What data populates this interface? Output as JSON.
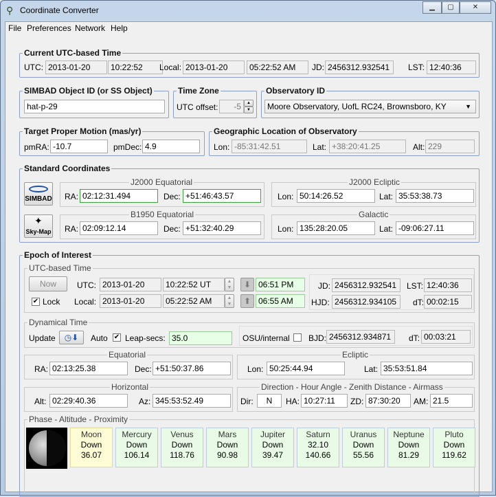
{
  "window": {
    "title": "Coordinate Converter",
    "min": "▁",
    "max": "▢",
    "close": "✕"
  },
  "menu": [
    "File",
    "Preferences",
    "Network",
    "Help"
  ],
  "utc": {
    "title": "Current UTC-based Time",
    "utc_label": "UTC:",
    "utc_date": "2013-01-20",
    "utc_time": "10:22:52",
    "local_label": "Local:",
    "local_date": "2013-01-20",
    "local_time": "05:22:52 AM",
    "jd_label": "JD:",
    "jd": "2456312.932541",
    "lst_label": "LST:",
    "lst": "12:40:36"
  },
  "simbad": {
    "title": "SIMBAD Object ID (or SS Object)",
    "value": "hat-p-29"
  },
  "timezone": {
    "title": "Time Zone",
    "label": "UTC offset:",
    "value": "-5"
  },
  "observatory": {
    "title": "Observatory ID",
    "value": "Moore Observatory, UofL RC24, Brownsboro, KY"
  },
  "motion": {
    "title": "Target Proper Motion (mas/yr)",
    "pmra_label": "pmRA:",
    "pmra": "-10.7",
    "pmdec_label": "pmDec:",
    "pmdec": "4.9"
  },
  "geo": {
    "title": "Geographic Location of Observatory",
    "lon_label": "Lon:",
    "lon": "-85:31:42.51",
    "lat_label": "Lat:",
    "lat": "+38:20:41.25",
    "alt_label": "Alt:",
    "alt": "229"
  },
  "std": {
    "title": "Standard Coordinates",
    "simbad_btn": "SIMBAD",
    "skymap_btn": "Sky-Map",
    "j2000eq": {
      "title": "J2000 Equatorial",
      "ra_label": "RA:",
      "ra": "02:12:31.494",
      "dec_label": "Dec:",
      "dec": "+51:46:43.57"
    },
    "j2000ec": {
      "title": "J2000 Ecliptic",
      "lon_label": "Lon:",
      "lon": "50:14:26.52",
      "lat_label": "Lat:",
      "lat": "35:53:38.73"
    },
    "b1950": {
      "title": "B1950 Equatorial",
      "ra_label": "RA:",
      "ra": "02:09:12.14",
      "dec_label": "Dec:",
      "dec": "+51:32:40.29"
    },
    "galactic": {
      "title": "Galactic",
      "lon_label": "Lon:",
      "lon": "135:28:20.05",
      "lat_label": "Lat:",
      "lat": "-09:06:27.11"
    }
  },
  "epoch": {
    "title": "Epoch of Interest",
    "utcb": {
      "title": "UTC-based Time",
      "now": "Now",
      "lock": "Lock",
      "utc_label": "UTC:",
      "utc_date": "2013-01-20",
      "utc_time": "10:22:52 UT",
      "local_label": "Local:",
      "local_date": "2013-01-20",
      "local_time": "05:22:52 AM",
      "set_time": "06:51 PM",
      "rise_time": "06:55 AM",
      "jd_label": "JD:",
      "jd": "2456312.932541",
      "lst_label": "LST:",
      "lst": "12:40:36",
      "hjd_label": "HJD:",
      "hjd": "2456312.934105",
      "dt_label": "dT:",
      "dt": "00:02:15"
    },
    "dyn": {
      "title": "Dynamical Time",
      "update": "Update",
      "auto": "Auto",
      "leap_label": "Leap-secs:",
      "leap": "35.0",
      "osu_label": "OSU/internal",
      "bjd_label": "BJD:",
      "bjd": "2456312.934871",
      "dt_label": "dT:",
      "dt": "00:03:21"
    },
    "eq": {
      "title": "Equatorial",
      "ra_label": "RA:",
      "ra": "02:13:25.38",
      "dec_label": "Dec:",
      "dec": "+51:50:37.86"
    },
    "ec": {
      "title": "Ecliptic",
      "lon_label": "Lon:",
      "lon": "50:25:44.94",
      "lat_label": "Lat:",
      "lat": "35:53:51.84"
    },
    "hor": {
      "title": "Horizontal",
      "alt_label": "Alt:",
      "alt": "02:29:40.36",
      "az_label": "Az:",
      "az": "345:53:52.49"
    },
    "dir": {
      "title": "Direction - Hour Angle - Zenith Distance - Airmass",
      "dir_label": "Dir:",
      "dir": "N",
      "ha_label": "HA:",
      "ha": "10:27:11",
      "zd_label": "ZD:",
      "zd": "87:30:20",
      "am_label": "AM:",
      "am": "21.5"
    },
    "phase": {
      "title": "Phase - Altitude - Proximity",
      "planets": [
        {
          "name": "Moon",
          "state": "Down",
          "val": "36.07"
        },
        {
          "name": "Mercury",
          "state": "Down",
          "val": "106.14"
        },
        {
          "name": "Venus",
          "state": "Down",
          "val": "118.76"
        },
        {
          "name": "Mars",
          "state": "Down",
          "val": "90.98"
        },
        {
          "name": "Jupiter",
          "state": "Down",
          "val": "39.47"
        },
        {
          "name": "Saturn",
          "state": "32.10",
          "val": "140.66"
        },
        {
          "name": "Uranus",
          "state": "Down",
          "val": "55.56"
        },
        {
          "name": "Neptune",
          "state": "Down",
          "val": "81.29"
        },
        {
          "name": "Pluto",
          "state": "Down",
          "val": "119.62"
        }
      ]
    }
  }
}
